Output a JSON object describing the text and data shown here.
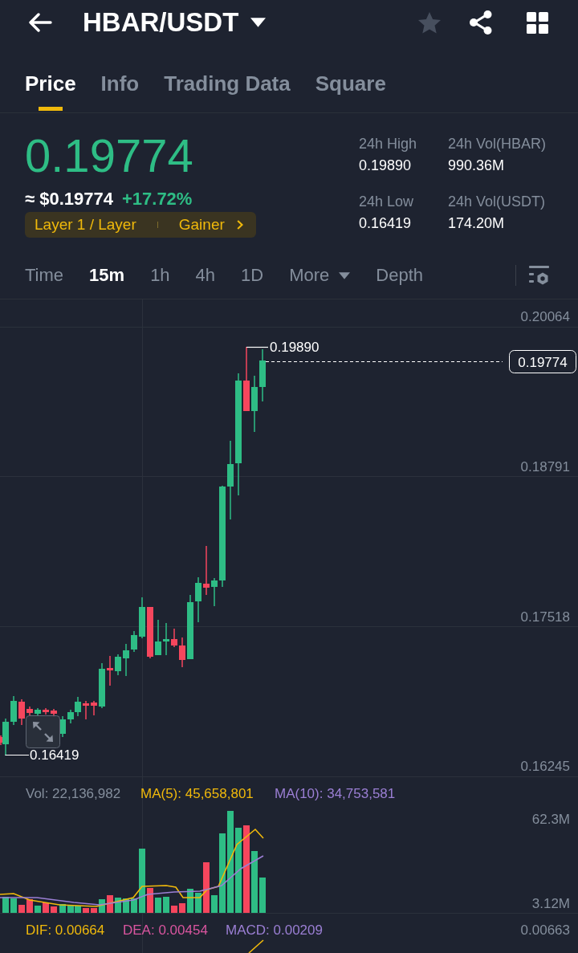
{
  "header": {
    "title": "HBAR/USDT",
    "favorite": false
  },
  "tabs": [
    {
      "label": "Price",
      "selected": true
    },
    {
      "label": "Info",
      "selected": false
    },
    {
      "label": "Trading Data",
      "selected": false
    },
    {
      "label": "Square",
      "selected": false
    }
  ],
  "price": {
    "last": "0.19774",
    "fiat": "≈ $0.19774",
    "change": "+17.72%",
    "tags": [
      "Layer 1 / Layer",
      "Gainer"
    ]
  },
  "stats": [
    {
      "label": "24h High",
      "value": "0.19890"
    },
    {
      "label": "24h Vol(HBAR)",
      "value": "990.36M"
    },
    {
      "label": "24h Low",
      "value": "0.16419"
    },
    {
      "label": "24h Vol(USDT)",
      "value": "174.20M"
    }
  ],
  "intervals": [
    {
      "label": "Time",
      "kind": "option",
      "selected": false
    },
    {
      "label": "15m",
      "kind": "option",
      "selected": true
    },
    {
      "label": "1h",
      "kind": "option",
      "selected": false
    },
    {
      "label": "4h",
      "kind": "option",
      "selected": false
    },
    {
      "label": "1D",
      "kind": "option",
      "selected": false
    },
    {
      "label": "More",
      "kind": "dropdown",
      "selected": false
    },
    {
      "label": "Depth",
      "kind": "option",
      "selected": false
    }
  ],
  "chart": {
    "price_axis": [
      "0.20064",
      "0.18791",
      "0.17518",
      "0.16245"
    ],
    "high_label": "0.19890",
    "low_label": "0.16419",
    "last_price_tag": "0.19774"
  },
  "volume": {
    "legend": [
      {
        "text": "Vol: 22,136,982",
        "color": "#848e9c"
      },
      {
        "text": "MA(5): 45,658,801",
        "color": "#f0b90b"
      },
      {
        "text": "MA(10): 34,753,581",
        "color": "#9b7fd4"
      }
    ],
    "axis": [
      "62.3M",
      "3.12M"
    ]
  },
  "macd": {
    "legend": [
      {
        "text": "DIF: 0.00664",
        "color": "#f0b90b"
      },
      {
        "text": "DEA: 0.00454",
        "color": "#d9559f"
      },
      {
        "text": "MACD: 0.00209",
        "color": "#9b7fd4"
      }
    ],
    "axis": [
      "0.00663"
    ]
  }
}
